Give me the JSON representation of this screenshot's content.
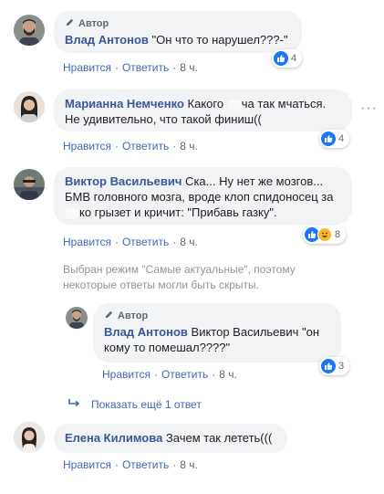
{
  "author_tag": "Автор",
  "actions": {
    "like": "Нравится",
    "reply": "Ответить",
    "separator": "·"
  },
  "comments": [
    {
      "name": "Влад Антонов",
      "text": "\"Он что то нарушел???-\"",
      "time": "8 ч.",
      "reactions": "4"
    },
    {
      "name": "Марианна Немченко",
      "text_a": "Какого ",
      "text_b": "ча так мчаться.",
      "text_line2": "Не удивительно, что такой финиш((",
      "time": "8 ч.",
      "reactions": "4"
    },
    {
      "name": "Виктор Васильевич",
      "text_line1": " Ска... Ну нет же мозгов...",
      "text_line2": "БМВ головного мозга, вроде клоп спидоносец за",
      "text_line3": "ко грызет и кричит: \"Прибавь газку\".",
      "time": "8 ч.",
      "reactions": "8"
    }
  ],
  "notice_line1": "Выбран режим \"Самые актуальные\", поэтому",
  "notice_line2": "некоторые ответы могли быть скрыты.",
  "reply": {
    "name": "Влад Антонов",
    "text_line1": " Виктор Васильевич \"он",
    "text_line2": "кому то помешал????\"",
    "time": "8 ч.",
    "reactions": "3"
  },
  "show_more": "Показать ещё 1 ответ",
  "last_comment": {
    "name": "Елена Килимова",
    "text": " Зачем так лететь(((",
    "time": "8 ч."
  },
  "colors": {
    "link": "#385898",
    "action": "#4267b2",
    "bubble": "#f2f3f5",
    "like": "#1877f2",
    "haha": "#f7b928"
  }
}
